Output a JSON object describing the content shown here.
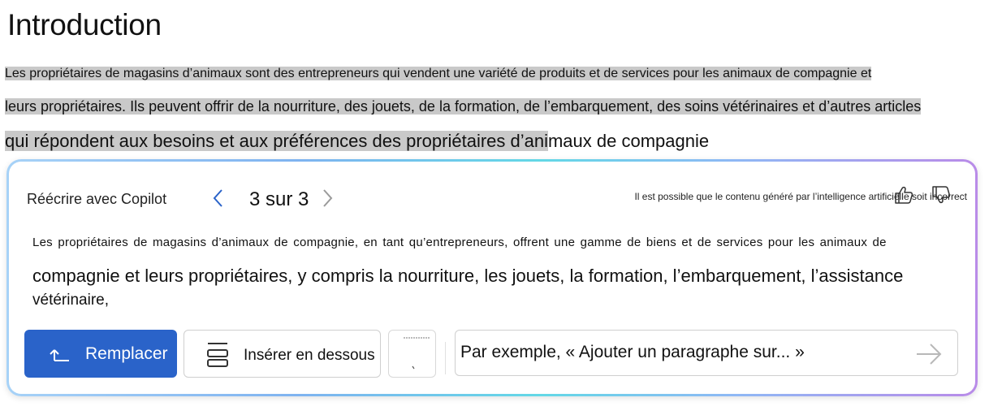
{
  "document": {
    "heading": "Introduction",
    "line1": "Les propriétaires de magasins d’animaux sont des entrepreneurs qui vendent une variété de produits et de services pour les animaux de compagnie et",
    "line2": "leurs propriétaires. Ils peuvent offrir de la nourriture, des jouets, de la formation, de l’embarquement, des soins vétérinaires et d’autres articles",
    "line3_highlighted": "qui répondent aux besoins et aux préférences des propriétaires d’ani",
    "line3_rest": "maux de compagnie"
  },
  "copilot": {
    "title": "Réécrire avec Copilot",
    "counter": "3 sur 3",
    "disclaimer": "Il est possible que le contenu généré par l’intelligence artificielle soit incorrect",
    "rewrite_line1": "Les propriétaires de magasins d’animaux de compagnie, en tant qu’entrepreneurs, offrent une gamme de biens et de services pour les animaux de",
    "rewrite_line2": "compagnie et leurs propriétaires, y compris la nourriture, les jouets, la formation, l’embarquement, l’assistance",
    "rewrite_line3": "vétérinaire,",
    "replace_label": "Remplacer",
    "insert_label": "Insérer en dessous",
    "prompt_placeholder": "Par exemple, « Ajouter un paragraphe sur... »",
    "icons": {
      "prev": "chevron-left-icon",
      "next": "chevron-right-icon",
      "thumbs_up": "thumbs-up-icon",
      "thumbs_down": "thumbs-down-icon",
      "replace": "replace-arrow-icon",
      "insert": "insert-below-icon",
      "send": "arrow-right-icon"
    },
    "colors": {
      "accent": "#2a63c9",
      "highlight": "#c9c9c9"
    }
  }
}
